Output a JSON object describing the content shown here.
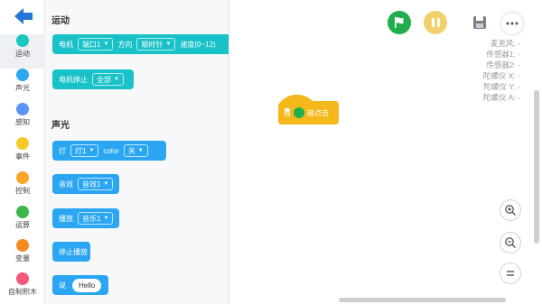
{
  "rail": {
    "back_label": "back",
    "categories": [
      {
        "label": "运动",
        "color": "#1cc6c0"
      },
      {
        "label": "声光",
        "color": "#2ea7f0"
      },
      {
        "label": "感知",
        "color": "#5a95f5"
      },
      {
        "label": "事件",
        "color": "#f5cb28"
      },
      {
        "label": "控制",
        "color": "#f7a62a"
      },
      {
        "label": "运算",
        "color": "#3cb64a"
      },
      {
        "label": "变量",
        "color": "#f58a1e"
      },
      {
        "label": "自制积木",
        "color": "#f2597d"
      }
    ]
  },
  "palette": {
    "motion_title": "运动",
    "motor_block": {
      "label": "电机",
      "port": "端口1",
      "dir_label": "方向",
      "dir": "顺时针",
      "speed_label": "速度(0~12)"
    },
    "motor_stop_block": {
      "label": "电机停止",
      "option": "全部"
    },
    "sound_title": "声光",
    "light_block": {
      "label": "灯",
      "light": "灯1",
      "color_label": "color",
      "state": "关"
    },
    "sfx_block": {
      "label": "音效",
      "option": "音效1"
    },
    "play_block": {
      "label": "播放",
      "option": "音乐1"
    },
    "stop_play_block": {
      "label": "停止播放"
    },
    "say_block": {
      "label": "说",
      "text": "Hello"
    }
  },
  "stage": {
    "sensors": [
      "麦克风: -",
      "传感器1: -",
      "传感器2: -",
      "陀螺仪 X: -",
      "陀螺仪 Y: -",
      "陀螺仪 A: -"
    ],
    "hat_block": {
      "prefix": "当",
      "suffix": "被点击"
    }
  },
  "colors": {
    "motion": "#18c2c8",
    "sound": "#2aa6f2",
    "event": "#f5b81b",
    "run": "#1fae4b",
    "pause": "#f3d06e",
    "back_arrow": "#2277d6"
  }
}
